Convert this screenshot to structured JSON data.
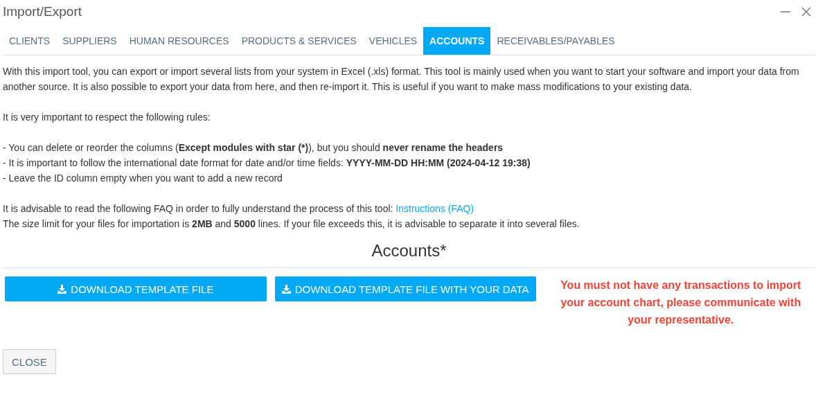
{
  "window": {
    "title": "Import/Export"
  },
  "tabs": [
    {
      "label": "CLIENTS",
      "selected": false
    },
    {
      "label": "SUPPLIERS",
      "selected": false
    },
    {
      "label": "HUMAN RESOURCES",
      "selected": false
    },
    {
      "label": "PRODUCTS & SERVICES",
      "selected": false
    },
    {
      "label": "VEHICLES",
      "selected": false
    },
    {
      "label": "ACCOUNTS",
      "selected": true
    },
    {
      "label": "RECEIVABLES/PAYABLES",
      "selected": false
    }
  ],
  "intro": "With this import tool, you can export or import several lists from your system in Excel (.xls) format. This tool is mainly used when you want to start your software and import your data from another source. It is also possible to export your data from here, and then re-import it. This is useful if you want to make mass modifications to your existing data.",
  "rules_heading": "It is very important to respect the following rules:",
  "rules": [
    "- You can delete or reorder the columns (**Except modules with star (*)**), but you should **never rename the headers**",
    "- It is important to follow the international date format for date and/or time fields: **YYYY-MM-DD HH:MM (2024-04-12 19:38)**",
    "- Leave the ID column empty when you want to add a new record"
  ],
  "faq": {
    "text": "It is advisable to read the following FAQ in order to fully understand the process of this tool:",
    "link": "Instructions (FAQ)"
  },
  "size_limit": "The size limit for your files for importation is **2MB** and **5000** lines. If your file exceeds this, it is advisable to separate it into several files.",
  "section_title": "Accounts*",
  "buttons": [
    "DOWNLOAD TEMPLATE FILE",
    "DOWNLOAD TEMPLATE FILE WITH YOUR DATA"
  ],
  "warning": "You must not have any transactions to import your account chart, please communicate with your representative.",
  "close_button": "CLOSE"
}
